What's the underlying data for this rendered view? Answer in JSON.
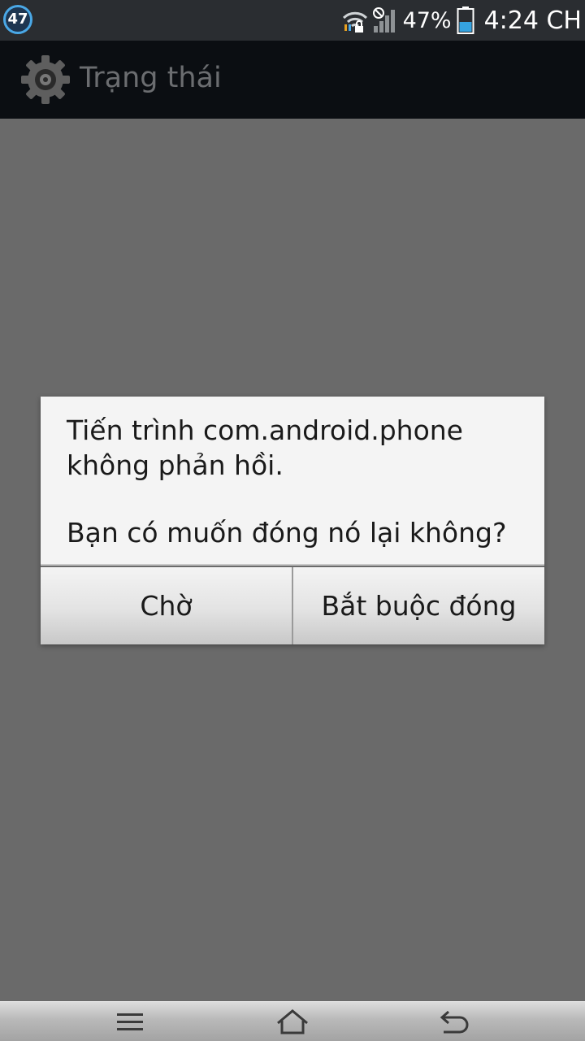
{
  "status_bar": {
    "notification_count": "47",
    "battery_percent": "47%",
    "time": "4:24 CH",
    "icons": [
      "wifi-lock-icon",
      "no-signal-icon",
      "battery-icon"
    ],
    "accent_color": "#4aa8e6"
  },
  "action_bar": {
    "title": "Trạng thái",
    "icon": "settings-gear-icon"
  },
  "dialog": {
    "message_line1": "Tiến trình com.android.phone",
    "message_line2": "không phản hồi.",
    "question": "Bạn có muốn đóng nó lại không?",
    "wait_label": "Chờ",
    "force_close_label": "Bắt buộc đóng"
  },
  "nav_bar": {
    "icons": [
      "menu-icon",
      "home-icon",
      "back-icon"
    ]
  }
}
